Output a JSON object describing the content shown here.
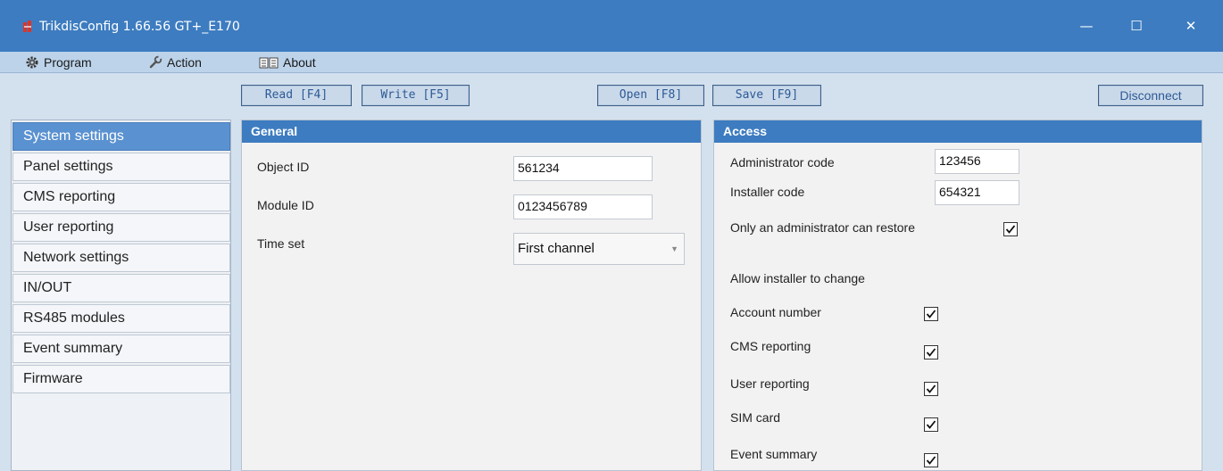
{
  "window": {
    "title": "TrikdisConfig 1.66.56   GT+_E170",
    "minimize_glyph": "—",
    "maximize_glyph": "☐",
    "close_glyph": "✕"
  },
  "menu": {
    "program": "Program",
    "action": "Action",
    "about": "About"
  },
  "toolbar": {
    "read": "Read [F4]",
    "write": "Write [F5]",
    "open": "Open [F8]",
    "save": "Save [F9]",
    "disconnect": "Disconnect"
  },
  "sidebar": {
    "items": [
      {
        "label": "System settings"
      },
      {
        "label": "Panel settings"
      },
      {
        "label": "CMS reporting"
      },
      {
        "label": "User reporting"
      },
      {
        "label": "Network settings"
      },
      {
        "label": "IN/OUT"
      },
      {
        "label": "RS485 modules"
      },
      {
        "label": "Event summary"
      },
      {
        "label": "Firmware"
      }
    ],
    "active_index": 0
  },
  "general": {
    "header": "General",
    "object_id_label": "Object ID",
    "object_id_value": "561234",
    "module_id_label": "Module ID",
    "module_id_value": "0123456789",
    "time_set_label": "Time set",
    "time_set_value": "First channel"
  },
  "access": {
    "header": "Access",
    "admin_code_label": "Administrator code",
    "admin_code_value": "123456",
    "installer_code_label": "Installer code",
    "installer_code_value": "654321",
    "only_admin_restore_label": "Only an administrator can restore",
    "only_admin_restore_checked": true,
    "allow_installer_label": "Allow installer to change",
    "permissions": [
      {
        "label": "Account number",
        "checked": true
      },
      {
        "label": "CMS reporting",
        "checked": true
      },
      {
        "label": "User reporting",
        "checked": true
      },
      {
        "label": "SIM card",
        "checked": true
      },
      {
        "label": "Event summary",
        "checked": true
      }
    ]
  },
  "colors": {
    "titlebar": "#3d7cc0",
    "menubar": "#bcd3ea",
    "panel_header": "#3d7cc0",
    "sidebar_active": "#5a91d0",
    "app_icon": "#d9362b"
  }
}
